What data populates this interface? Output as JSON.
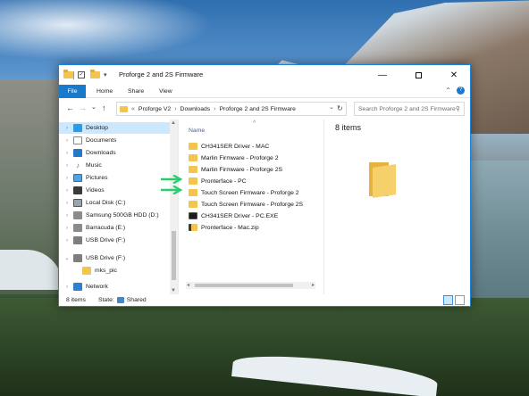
{
  "window": {
    "title": "Proforge 2 and 2S Firmware",
    "minimize_glyph": "—",
    "close_glyph": "✕"
  },
  "quick_access": {
    "check": "✓",
    "dropdown": "▾"
  },
  "ribbon": {
    "tabs": [
      "File",
      "Home",
      "Share",
      "View"
    ],
    "collapse_glyph": "⌃",
    "help_glyph": "?"
  },
  "navigation": {
    "back_glyph": "←",
    "forward_glyph": "→",
    "recent_glyph": "⌄",
    "up_glyph": "↑",
    "overflow": "«",
    "separator": "›",
    "breadcrumbs": [
      "Proforge V2",
      "Downloads",
      "Proforge 2 and 2S Firmware"
    ],
    "dropdown_glyph": "⌄",
    "refresh_glyph": "↻",
    "search_placeholder": "Search Proforge 2 and 2S Firmware",
    "search_glyph": "⚲"
  },
  "nav_pane": {
    "items": [
      {
        "label": "Desktop",
        "icon": "desktop-icon",
        "expander": "›",
        "selected": true
      },
      {
        "label": "Documents",
        "icon": "documents-icon",
        "expander": "›"
      },
      {
        "label": "Downloads",
        "icon": "downloads-icon",
        "expander": "›"
      },
      {
        "label": "Music",
        "icon": "music-icon",
        "expander": "›"
      },
      {
        "label": "Pictures",
        "icon": "pictures-icon",
        "expander": "›"
      },
      {
        "label": "Videos",
        "icon": "videos-icon",
        "expander": "›"
      },
      {
        "label": "Local Disk (C:)",
        "icon": "local-disk-icon",
        "expander": "›"
      },
      {
        "label": "Samsung 500GB HDD (D:)",
        "icon": "hdd-icon",
        "expander": "›"
      },
      {
        "label": "Barracuda (E:)",
        "icon": "hdd-icon",
        "expander": "›"
      },
      {
        "label": "USB Drive (F:)",
        "icon": "usb-drive-icon",
        "expander": "›"
      },
      {
        "label": "USB Drive (F:)",
        "icon": "usb-drive-icon",
        "expander": "⌄"
      },
      {
        "label": "mks_pic",
        "icon": "folder-icon",
        "expander": ""
      },
      {
        "label": "Network",
        "icon": "network-icon",
        "expander": "›"
      }
    ],
    "scroll_up": "▲",
    "scroll_down": "▼"
  },
  "file_list": {
    "column_header": "Name",
    "sort_glyph": "^",
    "files": [
      {
        "name": "CH341SER Driver - MAC",
        "type": "folder"
      },
      {
        "name": "Marlin Firmware - Proforge 2",
        "type": "folder"
      },
      {
        "name": "Marlin Firmware - Proforge 2S",
        "type": "folder"
      },
      {
        "name": "Pronterface - PC",
        "type": "folder"
      },
      {
        "name": "Touch Screen Firmware - Proforge 2",
        "type": "folder"
      },
      {
        "name": "Touch Screen Firmware - Proforge 2S",
        "type": "folder"
      },
      {
        "name": "CH341SER Driver - PC.EXE",
        "type": "exe"
      },
      {
        "name": "Pronterface - Mac.zip",
        "type": "zip"
      }
    ],
    "scroll_left": "◂",
    "scroll_right": "▸"
  },
  "preview": {
    "count": "8 items"
  },
  "status": {
    "count": "8 items",
    "state_label": "State:",
    "state_value": "Shared"
  },
  "colors": {
    "accent": "#1979ca",
    "arrow": "#2ecc71",
    "folder": "#f3c44e"
  }
}
